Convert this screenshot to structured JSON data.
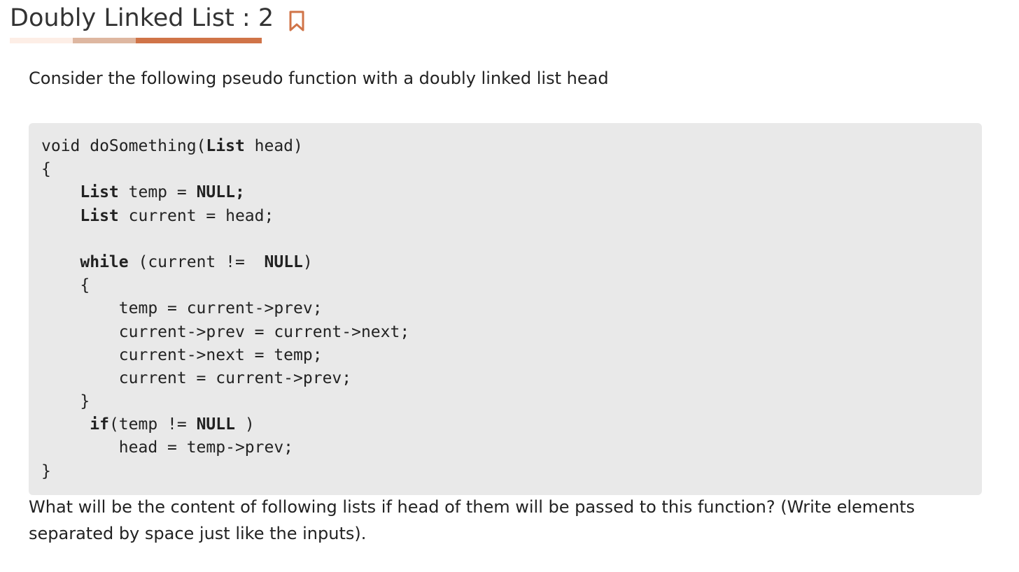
{
  "header": {
    "title": "Doubly Linked List : 2",
    "bookmark_icon": "bookmark-icon",
    "accent_color": "#d07448",
    "progress_colors": [
      "#fdeee6",
      "#deb7a1",
      "#d07448"
    ]
  },
  "question": {
    "intro": "Consider the following pseudo function with a doubly linked list head",
    "code_lines": [
      [
        {
          "t": "void doSomething("
        },
        {
          "t": "List",
          "b": true
        },
        {
          "t": " head)"
        }
      ],
      [
        {
          "t": "{"
        }
      ],
      [
        {
          "t": "    "
        },
        {
          "t": "List",
          "b": true
        },
        {
          "t": " temp = "
        },
        {
          "t": "NULL;",
          "b": true
        }
      ],
      [
        {
          "t": "    "
        },
        {
          "t": "List",
          "b": true
        },
        {
          "t": " current = head;"
        }
      ],
      [
        {
          "t": ""
        }
      ],
      [
        {
          "t": "    "
        },
        {
          "t": "while",
          "b": true
        },
        {
          "t": " (current !=  "
        },
        {
          "t": "NULL",
          "b": true
        },
        {
          "t": ")"
        }
      ],
      [
        {
          "t": "    {"
        }
      ],
      [
        {
          "t": "        temp = current->prev;"
        }
      ],
      [
        {
          "t": "        current->prev = current->next;"
        }
      ],
      [
        {
          "t": "        current->next = temp;"
        }
      ],
      [
        {
          "t": "        current = current->prev;"
        }
      ],
      [
        {
          "t": "    }"
        }
      ],
      [
        {
          "t": "     "
        },
        {
          "t": "if",
          "b": true
        },
        {
          "t": "(temp != "
        },
        {
          "t": "NULL",
          "b": true
        },
        {
          "t": " )"
        }
      ],
      [
        {
          "t": "        head = temp->prev;"
        }
      ],
      [
        {
          "t": "}"
        }
      ]
    ],
    "prompt": "What will be the content of following lists if head of them will be passed to this function? (Write elements separated by space just like the inputs)."
  }
}
